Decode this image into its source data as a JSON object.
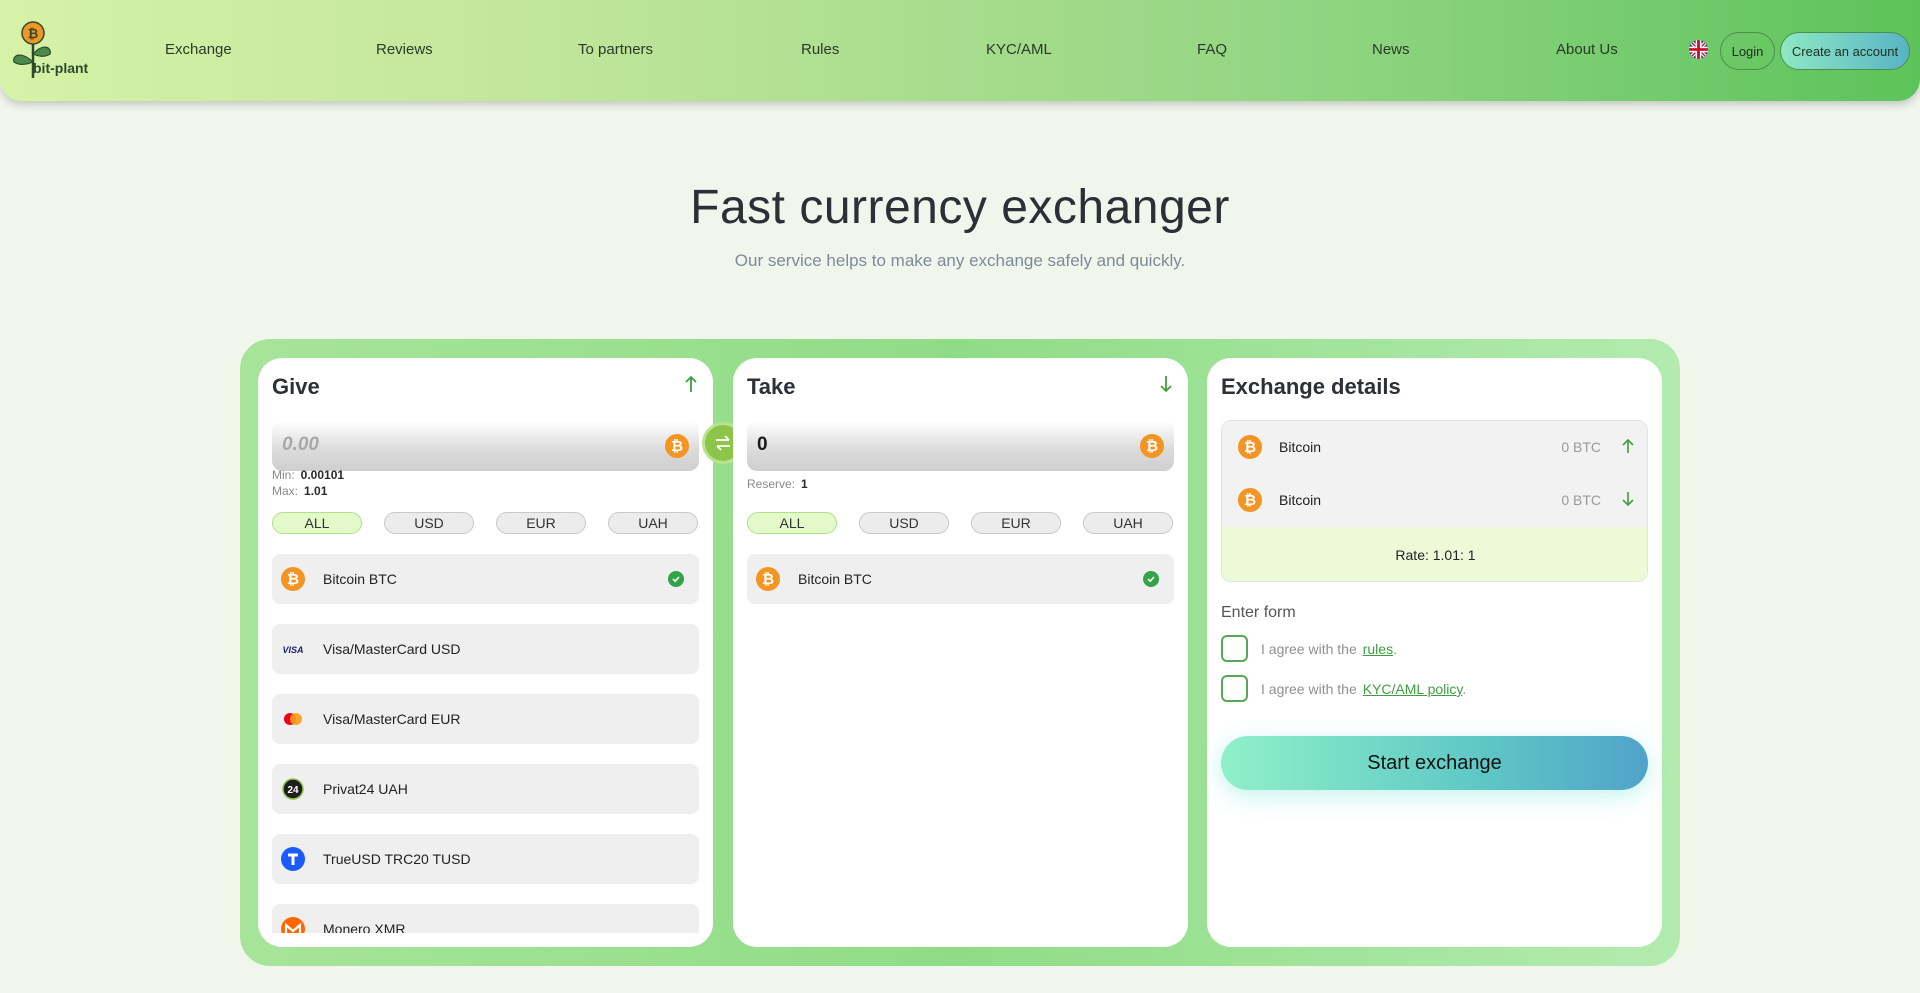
{
  "header": {
    "logo_text": "bit-plant",
    "nav": [
      "Exchange",
      "Reviews",
      "To partners",
      "Rules",
      "KYC/AML",
      "FAQ",
      "News",
      "About Us"
    ],
    "login_label": "Login",
    "create_label": "Create an account"
  },
  "hero": {
    "title": "Fast currency exchanger",
    "subtitle": "Our service helps to make any exchange safely and quickly."
  },
  "give": {
    "title": "Give",
    "amount_placeholder": "0.00",
    "min_label": "Min:",
    "min_value": "0.00101",
    "max_label": "Max:",
    "max_value": "1.01",
    "filters": [
      "ALL",
      "USD",
      "EUR",
      "UAH"
    ],
    "active_filter": "ALL",
    "items": [
      {
        "label": "Bitcoin BTC",
        "icon": "bitcoin-icon",
        "selected": true
      },
      {
        "label": "Visa/MasterCard USD",
        "icon": "visa-icon",
        "selected": false
      },
      {
        "label": "Visa/MasterCard EUR",
        "icon": "mastercard-icon",
        "selected": false
      },
      {
        "label": "Privat24 UAH",
        "icon": "privat24-icon",
        "selected": false
      },
      {
        "label": "TrueUSD TRC20 TUSD",
        "icon": "trueusd-icon",
        "selected": false
      },
      {
        "label": "Monero XMR",
        "icon": "monero-icon",
        "selected": false
      }
    ]
  },
  "take": {
    "title": "Take",
    "amount_value": "0",
    "reserve_label": "Reserve:",
    "reserve_value": "1",
    "filters": [
      "ALL",
      "USD",
      "EUR",
      "UAH"
    ],
    "active_filter": "ALL",
    "items": [
      {
        "label": "Bitcoin BTC",
        "icon": "bitcoin-icon",
        "selected": true
      }
    ]
  },
  "details": {
    "title": "Exchange details",
    "give_name": "Bitcoin",
    "give_amount": "0 BTC",
    "take_name": "Bitcoin",
    "take_amount": "0 BTC",
    "rate": "Rate: 1.01: 1",
    "enter_form": "Enter form",
    "agree_prefix": "I agree with the",
    "rules_link": "rules",
    "kyc_link": "KYC/AML policy",
    "start_label": "Start exchange"
  },
  "colors": {
    "accent_green": "#33a34a",
    "bitcoin_orange": "#f39423",
    "frame_green": "#8fdc86"
  }
}
